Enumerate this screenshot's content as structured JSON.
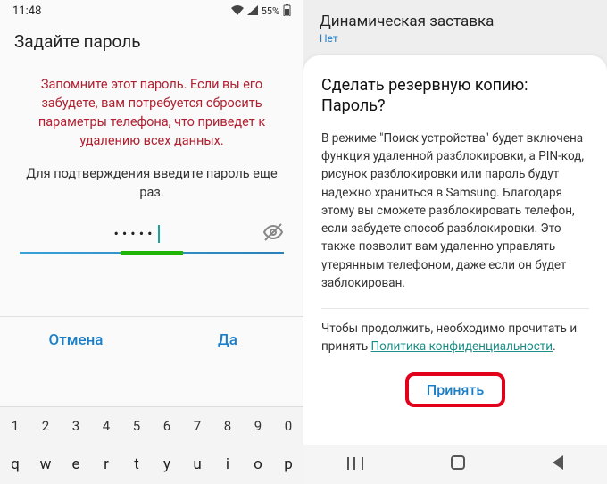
{
  "left": {
    "status": {
      "time": "11:48",
      "battery": "55%"
    },
    "title": "Задайте пароль",
    "warning": "Запомните этот пароль. Если вы его забудете, вам потребуется сбросить параметры телефона, что приведет к удалению всех данных.",
    "instruction": "Для подтверждения введите пароль еще раз.",
    "password_mask": "•••••",
    "buttons": {
      "cancel": "Отмена",
      "ok": "Да"
    },
    "keyboard": {
      "row1": [
        "1",
        "2",
        "3",
        "4",
        "5",
        "6",
        "7",
        "8",
        "9",
        "0"
      ],
      "row2": [
        "q",
        "w",
        "e",
        "r",
        "t",
        "y",
        "u",
        "i",
        "o",
        "p"
      ]
    }
  },
  "right": {
    "header": {
      "title": "Динамическая заставка",
      "sub": "Нет"
    },
    "sheet_title": "Сделать резервную копию: Пароль?",
    "body": "В режиме \"Поиск устройства\" будет включена функция удаленной разблокировки, а PIN-код, рисунок разблокировки или пароль будут надежно храниться в Samsung. Благодаря этому вы сможете разблокировать телефон, если забудете способ разблокировки. Это также позволит вам удаленно управлять утерянным телефоном, даже если он будет заблокирован.",
    "footer_prefix": "Чтобы продолжить, необходимо прочитать и принять ",
    "footer_link": "Политика конфиденциальности",
    "footer_suffix": ".",
    "accept": "Принять"
  }
}
